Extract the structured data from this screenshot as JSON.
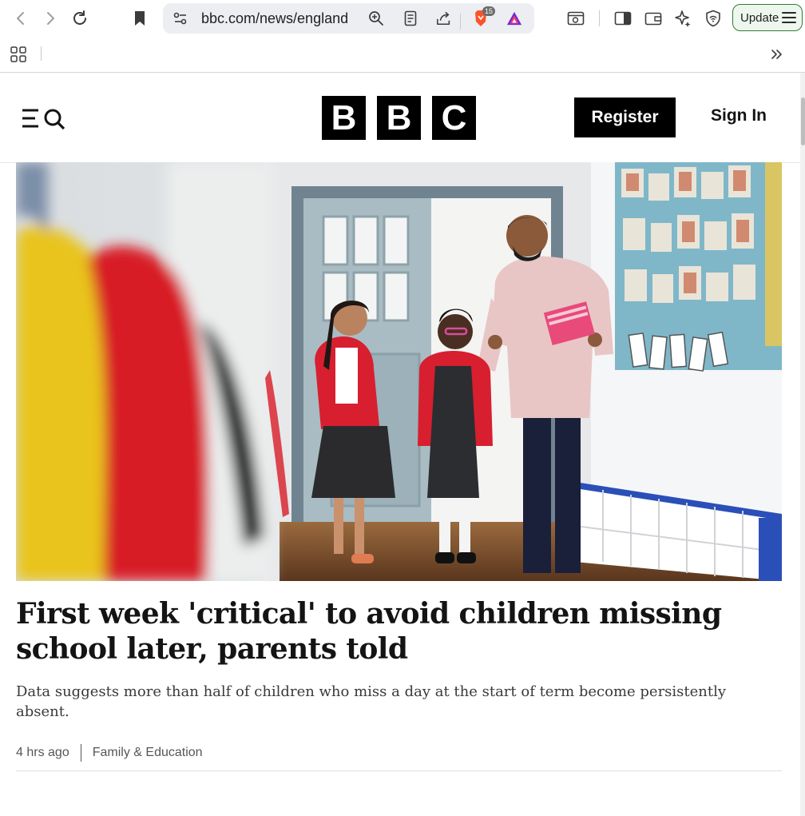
{
  "browser": {
    "url": "bbc.com/news/england",
    "update_label": "Update",
    "brave_shield_count": "15",
    "icons": [
      "back-icon",
      "forward-icon",
      "reload-icon",
      "bookmark-icon",
      "site-settings-icon",
      "zoom-icon",
      "reader-mode-icon",
      "share-icon",
      "brave-shield-icon",
      "brave-rewards-icon",
      "screenshot-icon",
      "sidebar-icon",
      "wallet-icon",
      "leo-ai-icon",
      "vpn-icon",
      "menu-icon",
      "apps-grid-icon",
      "more-bookmarks-icon"
    ]
  },
  "site": {
    "logo_letters": [
      "B",
      "B",
      "C"
    ],
    "register_label": "Register",
    "signin_label": "Sign In"
  },
  "article": {
    "headline": "First week 'critical' to avoid children missing school later, parents told",
    "summary": "Data suggests more than half of children who miss a day at the start of term become persistently absent.",
    "time": "4 hrs ago",
    "topic": "Family & Education"
  },
  "colors": {
    "brand_black": "#000000",
    "update_border": "#2e7d32",
    "urlbar_bg": "#eceef1"
  }
}
